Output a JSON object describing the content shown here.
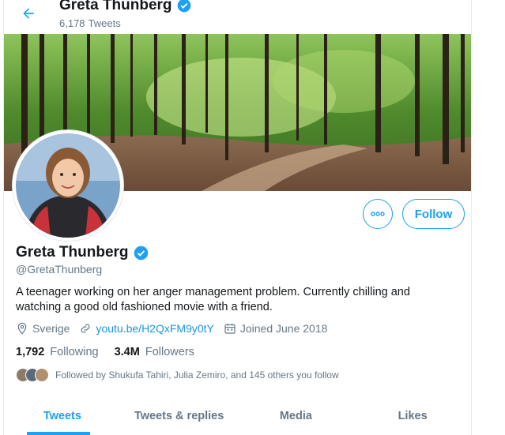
{
  "header": {
    "name": "Greta Thunberg",
    "tweet_count": "6,178",
    "tweet_word": "Tweets",
    "back_icon": "arrow-left-icon"
  },
  "profile": {
    "name": "Greta Thunberg",
    "handle": "@GretaThunberg",
    "verified_icon": "verified-badge-icon",
    "bio": "A teenager working on her anger management problem. Currently chilling and watching a good old fashioned movie with a friend.",
    "location": "Sverige",
    "website": "youtu.be/H2QxFM9y0tY",
    "joined": "Joined June 2018",
    "following_count": "1,792",
    "following_label": "Following",
    "followers_count": "3.4M",
    "followers_label": "Followers",
    "followed_by": "Followed by Shukufa Tahiri, Julia Zemiro, and 145 others you follow"
  },
  "actions": {
    "more_icon": "more-options-icon",
    "follow_label": "Follow"
  },
  "tabs": [
    {
      "label": "Tweets",
      "active": true
    },
    {
      "label": "Tweets & replies",
      "active": false
    },
    {
      "label": "Media",
      "active": false
    },
    {
      "label": "Likes",
      "active": false
    }
  ],
  "colors": {
    "accent": "#1da1f2",
    "link": "#1b95e0",
    "secondary_text": "#657786"
  }
}
